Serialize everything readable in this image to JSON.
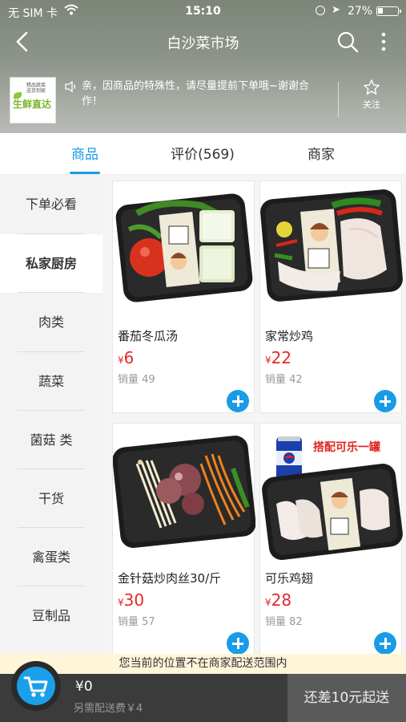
{
  "status_bar": {
    "carrier": "无 SIM 卡",
    "time": "15:10",
    "battery": "27%",
    "battery_level": 0.27
  },
  "nav": {
    "title": "白沙菜市场"
  },
  "shop": {
    "logo_text": "生鲜直达",
    "notice": "亲，因商品的特殊性，请尽量提前下单哦~谢谢合作！",
    "favorite_label": "关注"
  },
  "tabs": [
    {
      "label": "商品",
      "active": true
    },
    {
      "label": "评价(569)",
      "active": false
    },
    {
      "label": "商家",
      "active": false
    }
  ],
  "categories": [
    {
      "label": "下单必看",
      "active": false
    },
    {
      "label": "私家厨房",
      "active": true
    },
    {
      "label": "肉类",
      "active": false
    },
    {
      "label": "蔬菜",
      "active": false
    },
    {
      "label": "菌菇 类",
      "active": false
    },
    {
      "label": "干货",
      "active": false
    },
    {
      "label": "禽蛋类",
      "active": false
    },
    {
      "label": "豆制品",
      "active": false
    }
  ],
  "products": [
    {
      "name": "番茄冬瓜汤",
      "currency": "¥",
      "price": "6",
      "sales": "销量 49"
    },
    {
      "name": "家常炒鸡",
      "currency": "¥",
      "price": "22",
      "sales": "销量 42"
    },
    {
      "name": "金针菇炒肉丝30/斤",
      "currency": "¥",
      "price": "30",
      "sales": "销量 57"
    },
    {
      "name": "可乐鸡翅",
      "currency": "¥",
      "price": "28",
      "sales": "销量 82",
      "promo": "搭配可乐一罐"
    }
  ],
  "bottom": {
    "range_notice": "您当前的位置不在商家配送范围内",
    "total": "¥0",
    "delivery_fee": "另需配送费￥4",
    "checkout_label": "还差10元起送"
  },
  "colors": {
    "accent": "#1a9be6",
    "price": "#e12a2a",
    "cart_bar": "#3b3b3b"
  }
}
